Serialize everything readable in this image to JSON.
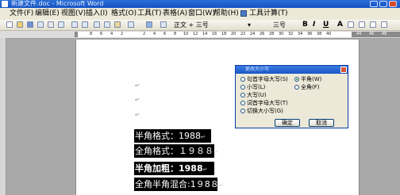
{
  "titlebar": {
    "title": "新建文件.doc - Microsoft Word"
  },
  "menu": [
    "文件(F)",
    "编辑(E)",
    "视图(V)",
    "插入(I)",
    "格式(O)",
    "工具(T)",
    "表格(A)",
    "窗口(W)",
    "帮助(H)",
    "工具计算(T)"
  ],
  "toolbar": {
    "style_value": "正文 + 三号",
    "size_value": "三号",
    "bold": "B",
    "italic": "I",
    "underline": "U",
    "font_color": "A"
  },
  "ruler": {
    "ticks": [
      "8",
      "6",
      "4",
      "2",
      "2",
      "4",
      "6",
      "8",
      "10",
      "12",
      "14",
      "16",
      "18",
      "20",
      "22",
      "24",
      "26",
      "28",
      "30",
      "32",
      "34",
      "36",
      "38",
      "40",
      "44",
      "46",
      "48"
    ]
  },
  "document": {
    "lines": [
      "半角格式：1988",
      "全角格式：１９８８",
      "半角加粗：1988",
      "全角半角混合:1９8８"
    ],
    "paragraph_mark": "↵"
  },
  "dialog": {
    "title": "更改大小写",
    "options_left": [
      "句首字母大写(S)",
      "小写(L)",
      "大写(U)",
      "词首字母大写(T)",
      "切换大小写(G)"
    ],
    "options_right": [
      "半角(W)",
      "全角(F)"
    ],
    "selected_right": "半角(W)",
    "ok_label": "确定",
    "cancel_label": "取消"
  }
}
